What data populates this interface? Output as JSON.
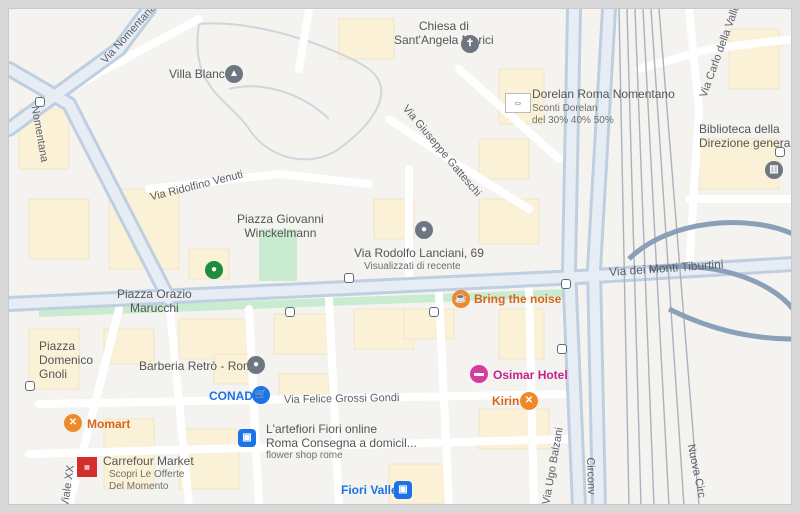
{
  "streets": {
    "via_nomentana_top": "Via Nomentana",
    "via_nomentana_left": "Nomentana",
    "via_rodolfo_venuti": "Via Ridolfino Venuti",
    "via_giuseppe_gatteschi": "Via Giuseppe Gatteschi",
    "via_monti_tiburtini": "Via dei Monti Tiburtini",
    "via_carlo_valle": "Via Carlo della Valle",
    "via_felice_grossi_gondi": "Via Felice Grossi Gondi",
    "via_ugo_balzani": "Via Ugo Balzani",
    "viale_xxi": "Viale XX",
    "circonv": "Circonv",
    "nuova_circ": "Nuova Circ"
  },
  "places": {
    "chiesa": "Chiesa di\nSant'Angela Merici",
    "villa_blanc": "Villa Blanc",
    "dorelan_title": "Dorelan Roma Nomentano",
    "dorelan_sub": "Sconti Dorelan\ndel 30% 40% 50%",
    "biblioteca": "Biblioteca della\nDirezione generale...",
    "piazza_winckelmann": "Piazza Giovanni\nWinckelmann",
    "via_lanciani": "Via Rodolfo Lanciani, 69",
    "via_lanciani_sub": "Visualizzati di recente",
    "piazza_marucchi": "Piazza Orazio\nMarucchi",
    "bring_the_noise": "Bring the noise",
    "barberia": "Barberia Retrò - Roma",
    "conad": "CONAD",
    "osimar": "Osimar Hotel",
    "kirin": "Kirin",
    "piazza_gnoli": "Piazza\nDomenico\nGnoli",
    "momart": "Momart",
    "artefiori": "L'artefiori Fiori online\nRoma Consegna a domicil...",
    "artefiori_sub": "flower shop rome",
    "carrefour": "Carrefour Market",
    "carrefour_sub": "Scopri Le Offerte\nDel Momento",
    "fiori_valle": "Fiori Valle"
  },
  "icons": {
    "church": "church-icon",
    "graduation": "graduation-cap-icon",
    "cafe": "coffee-cup-icon",
    "restaurant": "fork-knife-icon",
    "cart": "shopping-cart-icon",
    "bag": "shopping-bag-icon",
    "bed": "bed-icon",
    "bus": "bus-stop-icon"
  },
  "colors": {
    "road": "#ffffff",
    "road_casing": "#c8d3df",
    "arterial": "#b8c9db",
    "rail": "#a7b0bb",
    "park": "#c9ecd0",
    "building": "#fbf1d7",
    "land": "#f4f3f0"
  }
}
